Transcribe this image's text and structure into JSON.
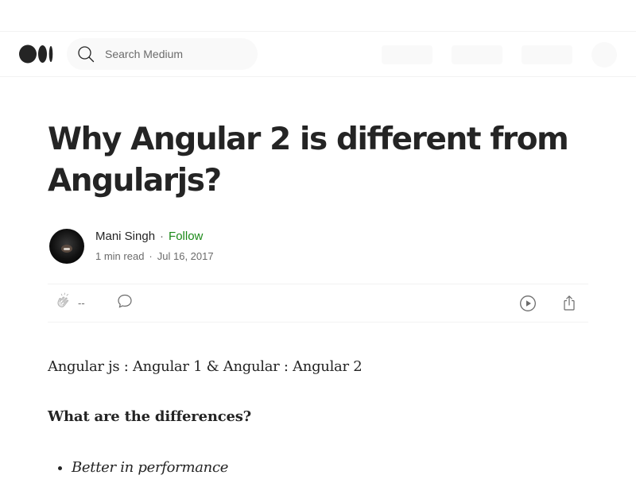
{
  "search": {
    "placeholder": "Search Medium"
  },
  "article": {
    "title": "Why Angular 2 is different from Angularjs?",
    "author": {
      "name": "Mani Singh",
      "follow_label": "Follow",
      "read_time": "1 min read",
      "date": "Jul 16, 2017",
      "separator": "·"
    },
    "actions": {
      "clap_count": "--"
    },
    "body": {
      "paragraph1": "Angular js : Angular 1 & Angular : Angular 2",
      "heading1": "What are the differences?",
      "list": [
        "Better in performance"
      ]
    }
  },
  "icons": {
    "logo": "medium-logo",
    "search": "search-icon",
    "clap": "clap-icon",
    "comment": "comment-icon",
    "listen": "play-icon",
    "share": "share-icon"
  },
  "colors": {
    "text": "#242424",
    "muted": "#6b6b6b",
    "follow": "#1a8917",
    "border": "#f2f2f2",
    "placeholder_bg": "#f9f9f9"
  }
}
